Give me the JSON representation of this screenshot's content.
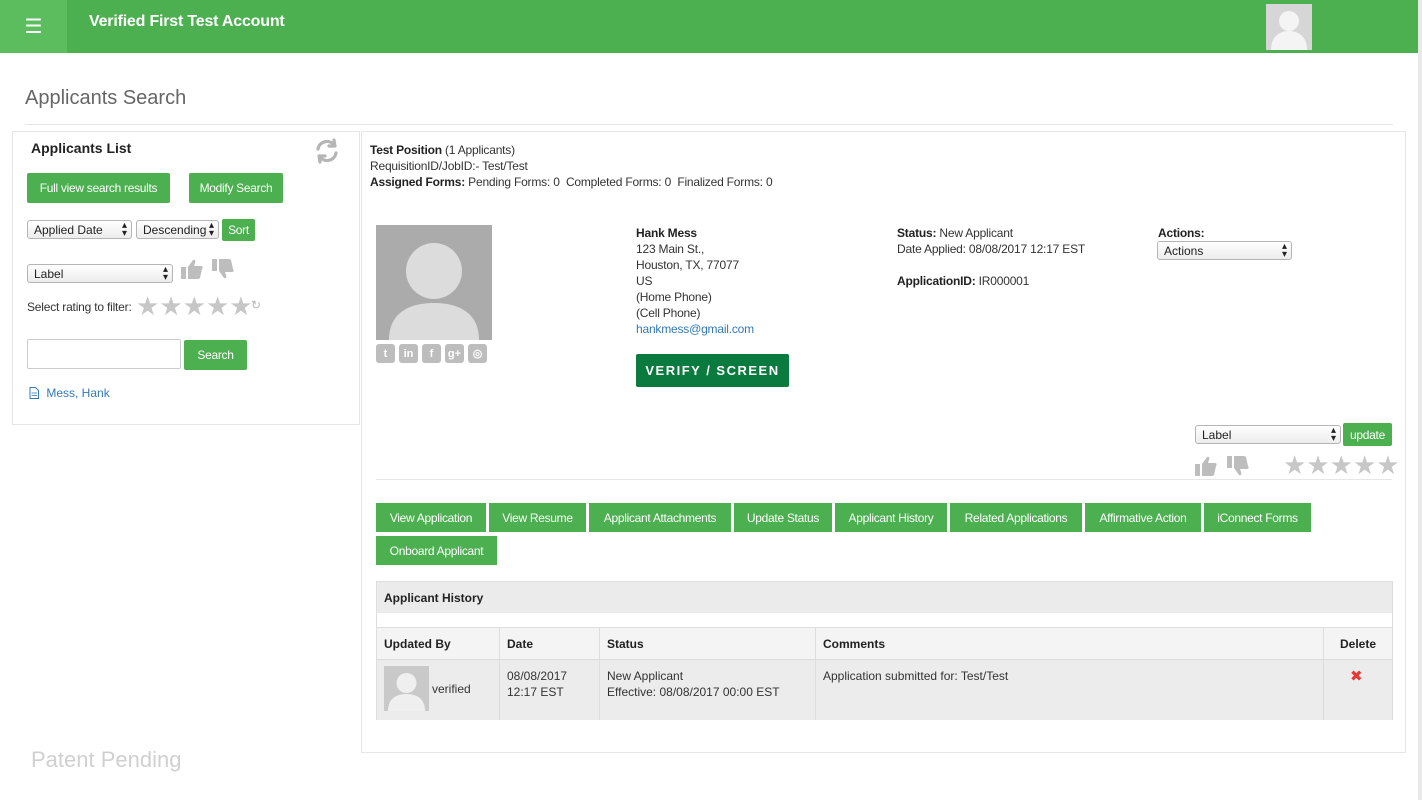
{
  "header": {
    "menu_icon": "hamburger-icon",
    "account_name": "Verified First Test Account",
    "avatar_icon": "user-avatar-icon"
  },
  "page": {
    "title": "Applicants Search"
  },
  "sidebar": {
    "title": "Applicants List",
    "refresh_icon": "refresh-icon",
    "full_view_button": "Full view search results",
    "modify_search_button": "Modify Search",
    "sort_field": "Applied Date",
    "sort_order": "Descending",
    "sort_button": "Sort",
    "label_select": "Label",
    "rating_filter_label": "Select rating to filter:",
    "search_value": "",
    "search_button": "Search",
    "applicants": [
      {
        "name": "Mess, Hank",
        "icon": "document-icon"
      }
    ]
  },
  "position": {
    "name": "Test Position",
    "applicant_count": "(1 Applicants)",
    "requisition": "RequisitionID/JobID:- Test/Test",
    "assigned_forms_label": "Assigned Forms:",
    "assigned_forms_value": "Pending Forms: 0  Completed Forms: 0  Finalized Forms: 0"
  },
  "applicant": {
    "name": "Hank Mess",
    "address1": "123 Main St.,",
    "address2": "Houston, TX, 77077",
    "country": "US",
    "home_phone": "(Home Phone)",
    "cell_phone": "(Cell Phone)",
    "email": "hankmess@gmail.com",
    "status_label": "Status:",
    "status_value": "New Applicant",
    "date_applied": "Date Applied: 08/08/2017 12:17 EST",
    "application_id_label": "ApplicationID:",
    "application_id_value": "IR000001",
    "actions_label": "Actions:",
    "actions_select": "Actions",
    "verify_button": "VERIFY / SCREEN",
    "social_icons": [
      "twitter-icon",
      "linkedin-icon",
      "facebook-icon",
      "google-plus-icon",
      "instagram-icon"
    ],
    "social_glyphs": [
      "t",
      "in",
      "f",
      "g+",
      "◎"
    ],
    "label_select": "Label",
    "update_button": "update"
  },
  "tabs": [
    "View Application",
    "View Resume",
    "Applicant Attachments",
    "Update Status",
    "Applicant History",
    "Related Applications",
    "Affirmative Action",
    "iConnect Forms",
    "Onboard Applicant"
  ],
  "history": {
    "title": "Applicant History",
    "columns": [
      "Updated By",
      "Date",
      "Status",
      "Comments",
      "Delete"
    ],
    "rows": [
      {
        "updated_by": "verified",
        "date_line1": "08/08/2017",
        "date_line2": "12:17 EST",
        "status_line1": "New Applicant",
        "status_line2": "Effective: 08/08/2017 00:00 EST",
        "comments": "Application submitted for: Test/Test",
        "delete_glyph": "✖"
      }
    ]
  },
  "footer": {
    "text": "Patent Pending"
  },
  "colors": {
    "brand_green": "#4caf50",
    "verify_green": "#0b7a3e",
    "delete_red": "#e53935",
    "link_blue": "#337ab7"
  }
}
